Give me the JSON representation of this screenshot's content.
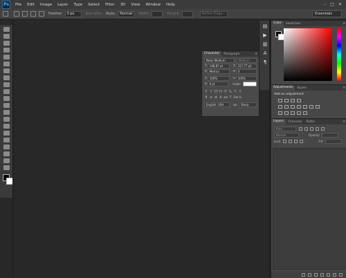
{
  "app": {
    "logo": "Ps"
  },
  "menu": [
    "File",
    "Edit",
    "Image",
    "Layer",
    "Type",
    "Select",
    "Filter",
    "3D",
    "View",
    "Window",
    "Help"
  ],
  "window_controls": [
    "–",
    "□",
    "✕"
  ],
  "options": {
    "feather_label": "Feather:",
    "feather_value": "0 px",
    "antialias_label": "Anti-alias",
    "style_label": "Style:",
    "style_value": "Normal",
    "width_label": "Width:",
    "height_label": "Height:",
    "refine_label": "Refine Edge...",
    "workspace": "Essentials"
  },
  "character": {
    "tabs": [
      "Character",
      "Paragraph"
    ],
    "font_family": "Neon Medium",
    "font_style": "Medium",
    "size": "148,87 pt",
    "leading": "317,77 pt",
    "kerning": "Metrics",
    "tracking": "0",
    "vscale": "100%",
    "hscale": "100%",
    "baseline": "0 pt",
    "color_label": "Color:",
    "language": "English: USA",
    "aa_label": "aa",
    "antialias": "Sharp"
  },
  "color_panel": {
    "tabs": [
      "Color",
      "Swatches"
    ]
  },
  "adjustments": {
    "tabs": [
      "Adjustments",
      "Styles"
    ],
    "title": "Add an adjustment"
  },
  "layers": {
    "tabs": [
      "Layers",
      "Channels",
      "Paths"
    ],
    "kind": "Kind",
    "blend": "Normal",
    "opacity_label": "Opacity:",
    "lock_label": "Lock:",
    "fill_label": "Fill:"
  },
  "icons": [
    "move-icon",
    "marquee-icon",
    "lasso-icon",
    "quick-select-icon",
    "crop-icon",
    "eyedropper-icon",
    "healing-icon",
    "brush-icon",
    "clone-stamp-icon",
    "history-brush-icon",
    "eraser-icon",
    "gradient-icon",
    "blur-icon",
    "dodge-icon",
    "pen-icon",
    "type-icon",
    "path-select-icon",
    "shape-icon",
    "hand-icon",
    "zoom-icon"
  ]
}
